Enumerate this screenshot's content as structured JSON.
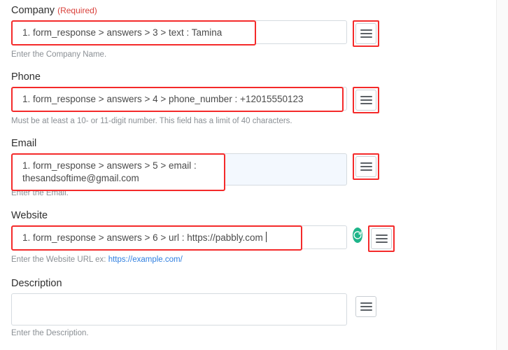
{
  "meta": {
    "accent_red": "#f42a2a",
    "link_blue": "#2f7fe0",
    "refresh_green": "#1fb58a"
  },
  "fields": [
    {
      "label": "Company",
      "required_text": "(Required)",
      "value": "1. form_response > answers > 3 > text : Tamina",
      "hint": "Enter the Company Name.",
      "mapper_icon": "hamburger-icon",
      "highlighted": true
    },
    {
      "label": "Phone",
      "required_text": "",
      "value": "1. form_response > answers > 4 > phone_number : +12015550123",
      "hint": "Must be at least a 10- or 11-digit number. This field has a limit of 40 characters.",
      "mapper_icon": "hamburger-icon",
      "highlighted": true
    },
    {
      "label": "Email",
      "required_text": "",
      "value": "1. form_response > answers > 5 > email : thesandsoftime@gmail.com",
      "hint": "Enter the Email.",
      "mapper_icon": "hamburger-icon",
      "highlighted": true
    },
    {
      "label": "Website",
      "required_text": "",
      "value": "1. form_response > answers > 6 > url : https://pabbly.com",
      "hint_prefix": "Enter the Website URL ex: ",
      "hint_link": "https://example.com/",
      "mapper_icon": "hamburger-icon",
      "refresh_icon": "refresh-icon",
      "highlighted": true
    },
    {
      "label": "Description",
      "required_text": "",
      "value": "",
      "placeholder": "",
      "hint": "Enter the Description.",
      "mapper_icon": "hamburger-icon",
      "highlighted": false
    }
  ]
}
